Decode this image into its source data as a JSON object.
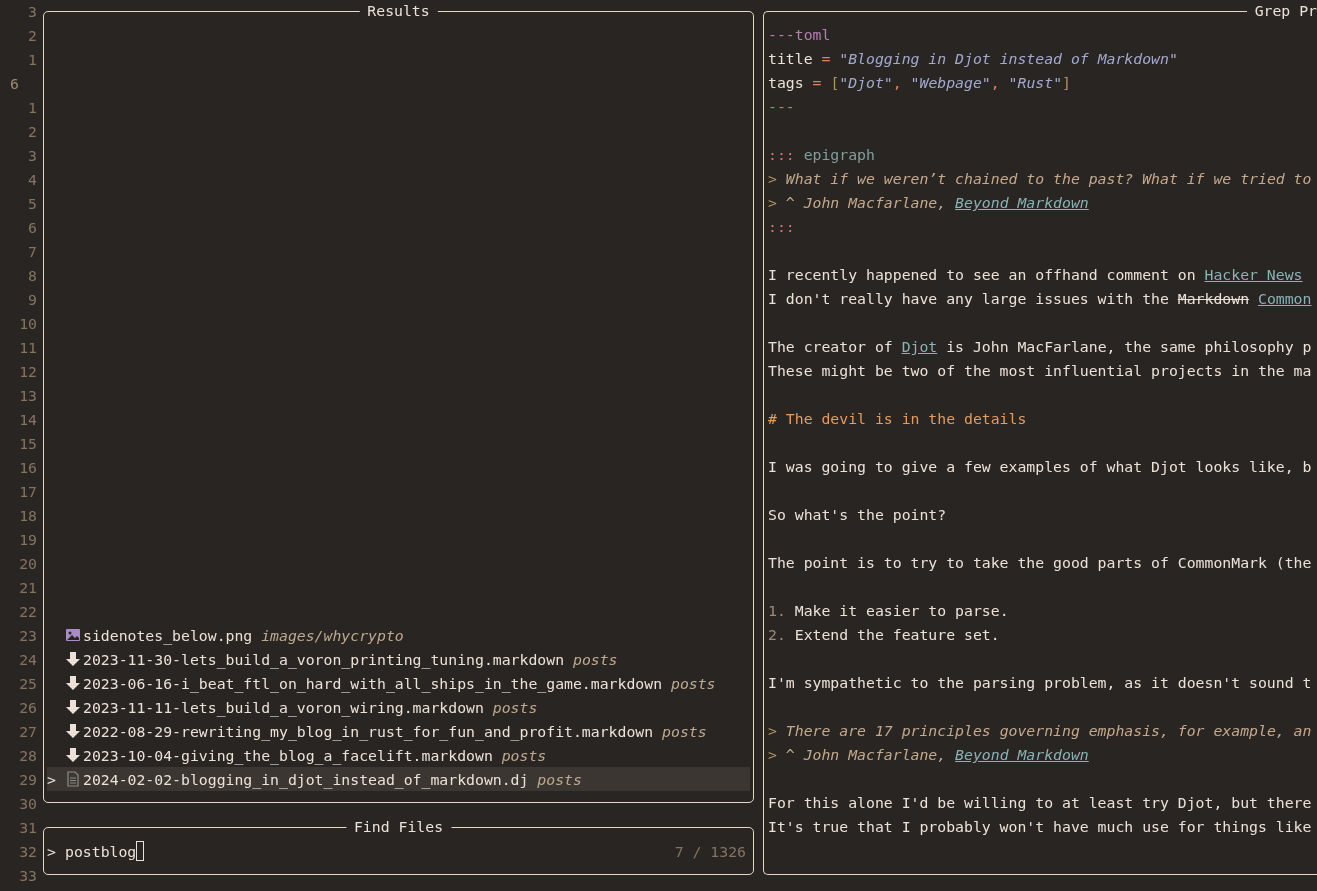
{
  "gutter": [
    {
      "number": "3",
      "current": false
    },
    {
      "number": "2",
      "current": false
    },
    {
      "number": "1",
      "current": false
    },
    {
      "number": "6",
      "current": true
    },
    {
      "number": "1",
      "current": false
    },
    {
      "number": "2",
      "current": false
    },
    {
      "number": "3",
      "current": false
    },
    {
      "number": "4",
      "current": false
    },
    {
      "number": "5",
      "current": false
    },
    {
      "number": "6",
      "current": false
    },
    {
      "number": "7",
      "current": false
    },
    {
      "number": "8",
      "current": false
    },
    {
      "number": "9",
      "current": false
    },
    {
      "number": "10",
      "current": false
    },
    {
      "number": "11",
      "current": false
    },
    {
      "number": "12",
      "current": false
    },
    {
      "number": "13",
      "current": false
    },
    {
      "number": "14",
      "current": false
    },
    {
      "number": "15",
      "current": false
    },
    {
      "number": "16",
      "current": false
    },
    {
      "number": "17",
      "current": false
    },
    {
      "number": "18",
      "current": false
    },
    {
      "number": "19",
      "current": false
    },
    {
      "number": "20",
      "current": false
    },
    {
      "number": "21",
      "current": false
    },
    {
      "number": "22",
      "current": false
    },
    {
      "number": "23",
      "current": false
    },
    {
      "number": "24",
      "current": false
    },
    {
      "number": "25",
      "current": false
    },
    {
      "number": "26",
      "current": false
    },
    {
      "number": "27",
      "current": false
    },
    {
      "number": "28",
      "current": false
    },
    {
      "number": "29",
      "current": false
    },
    {
      "number": "30",
      "current": false
    },
    {
      "number": "31",
      "current": false
    },
    {
      "number": "32",
      "current": false
    },
    {
      "number": "33",
      "current": false
    }
  ],
  "results": {
    "title": "Results",
    "selection_marker": ">",
    "items": [
      {
        "kind": "image",
        "name": "sidenotes_below.png",
        "dir": "images/whycrypto",
        "selected": false
      },
      {
        "kind": "markdown",
        "name": "2023-11-30-lets_build_a_voron_printing_tuning.markdown",
        "dir": "posts",
        "selected": false
      },
      {
        "kind": "markdown",
        "name": "2023-06-16-i_beat_ftl_on_hard_with_all_ships_in_the_game.markdown",
        "dir": "posts",
        "selected": false
      },
      {
        "kind": "markdown",
        "name": "2023-11-11-lets_build_a_voron_wiring.markdown",
        "dir": "posts",
        "selected": false
      },
      {
        "kind": "markdown",
        "name": "2022-08-29-rewriting_my_blog_in_rust_for_fun_and_profit.markdown",
        "dir": "posts",
        "selected": false
      },
      {
        "kind": "markdown",
        "name": "2023-10-04-giving_the_blog_a_facelift.markdown",
        "dir": "posts",
        "selected": false
      },
      {
        "kind": "document",
        "name": "2024-02-02-blogging_in_djot_instead_of_markdown.dj",
        "dir": "posts",
        "selected": true
      }
    ]
  },
  "finder": {
    "title": "Find Files",
    "prompt": ">",
    "query": "postblog",
    "count": "7 / 1326"
  },
  "preview": {
    "title": "Grep Pr",
    "lines": [
      {
        "kind": "text",
        "segments": [
          {
            "kind": "meta",
            "text": "---toml"
          }
        ]
      },
      {
        "kind": "text",
        "segments": [
          {
            "kind": "plain",
            "text": "title"
          },
          {
            "kind": "op",
            "text": " = "
          },
          {
            "kind": "string",
            "text": "\"Blogging in Djot instead of Markdown\""
          }
        ]
      },
      {
        "kind": "text",
        "segments": [
          {
            "kind": "plain",
            "text": "tags"
          },
          {
            "kind": "op",
            "text": " = "
          },
          {
            "kind": "bracket",
            "text": "["
          },
          {
            "kind": "string",
            "text": "\"Djot\""
          },
          {
            "kind": "op",
            "text": ", "
          },
          {
            "kind": "string",
            "text": "\"Webpage\""
          },
          {
            "kind": "op",
            "text": ", "
          },
          {
            "kind": "string",
            "text": "\"Rust\""
          },
          {
            "kind": "bracket",
            "text": "]"
          }
        ]
      },
      {
        "kind": "text",
        "segments": [
          {
            "kind": "fence",
            "text": "---"
          }
        ]
      },
      {
        "kind": "blank"
      },
      {
        "kind": "text",
        "segments": [
          {
            "kind": "fence",
            "text": ":::",
            "space_after": true
          },
          {
            "kind": "class",
            "text": "epigraph"
          }
        ]
      },
      {
        "kind": "text",
        "segments": [
          {
            "kind": "quote-mark",
            "text": "> "
          },
          {
            "kind": "quote",
            "text": "What if we weren’t chained to the past? What if we tried to"
          }
        ]
      },
      {
        "kind": "text",
        "segments": [
          {
            "kind": "quote-mark",
            "text": "> "
          },
          {
            "kind": "quote",
            "text": "^ John Macfarlane, "
          },
          {
            "kind": "link",
            "text": "Beyond Markdown"
          }
        ]
      },
      {
        "kind": "text",
        "segments": [
          {
            "kind": "fence",
            "text": ":::"
          }
        ]
      },
      {
        "kind": "blank"
      },
      {
        "kind": "text",
        "segments": [
          {
            "kind": "plain",
            "text": "I recently happened to see an offhand comment on "
          },
          {
            "kind": "link",
            "text": "Hacker News"
          }
        ]
      },
      {
        "kind": "text",
        "segments": [
          {
            "kind": "plain",
            "text": "I don't really have any large issues with the "
          },
          {
            "kind": "strike",
            "text": "Markdown",
            "space_after": true
          },
          {
            "kind": "link",
            "text": "Common"
          }
        ]
      },
      {
        "kind": "blank"
      },
      {
        "kind": "text",
        "segments": [
          {
            "kind": "plain",
            "text": "The creator of "
          },
          {
            "kind": "link",
            "text": "Djot"
          },
          {
            "kind": "plain",
            "text": " is John MacFarlane, the same philosophy p"
          }
        ]
      },
      {
        "kind": "text",
        "segments": [
          {
            "kind": "plain",
            "text": "These might be two of the most influential projects in the ma"
          }
        ]
      },
      {
        "kind": "blank"
      },
      {
        "kind": "text",
        "segments": [
          {
            "kind": "heading",
            "text": "# The devil is in the details"
          }
        ]
      },
      {
        "kind": "blank"
      },
      {
        "kind": "text",
        "segments": [
          {
            "kind": "plain",
            "text": "I was going to give a few examples of what Djot looks like, b"
          }
        ]
      },
      {
        "kind": "blank"
      },
      {
        "kind": "text",
        "segments": [
          {
            "kind": "plain",
            "text": "So what's the point?"
          }
        ]
      },
      {
        "kind": "blank"
      },
      {
        "kind": "text",
        "segments": [
          {
            "kind": "plain",
            "text": "The point is to try to take the good parts of CommonMark (the"
          }
        ]
      },
      {
        "kind": "blank"
      },
      {
        "kind": "text",
        "segments": [
          {
            "kind": "list-number",
            "text": "1. "
          },
          {
            "kind": "plain",
            "text": "Make it easier to parse."
          }
        ]
      },
      {
        "kind": "text",
        "segments": [
          {
            "kind": "list-number",
            "text": "2. "
          },
          {
            "kind": "plain",
            "text": "Extend the feature set."
          }
        ]
      },
      {
        "kind": "blank"
      },
      {
        "kind": "text",
        "segments": [
          {
            "kind": "plain",
            "text": "I'm sympathetic to the parsing problem, as it doesn't sound t"
          }
        ]
      },
      {
        "kind": "blank"
      },
      {
        "kind": "text",
        "segments": [
          {
            "kind": "quote-mark",
            "text": "> "
          },
          {
            "kind": "quote",
            "text": "There are 17 principles governing emphasis, for example, an"
          }
        ]
      },
      {
        "kind": "text",
        "segments": [
          {
            "kind": "quote-mark",
            "text": "> "
          },
          {
            "kind": "quote",
            "text": "^ John Macfarlane, "
          },
          {
            "kind": "link",
            "text": "Beyond Markdown"
          }
        ]
      },
      {
        "kind": "blank"
      },
      {
        "kind": "text",
        "segments": [
          {
            "kind": "plain",
            "text": "For this alone I'd be willing to at least try Djot, but there"
          }
        ]
      },
      {
        "kind": "text",
        "segments": [
          {
            "kind": "plain",
            "text": "It's true that I probably won't have much use for things like"
          }
        ]
      }
    ]
  }
}
